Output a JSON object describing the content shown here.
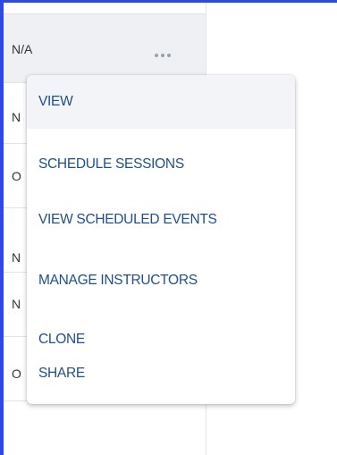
{
  "table": {
    "rows": [
      {
        "value": "N/A"
      },
      {
        "value": "N"
      },
      {
        "value": "O"
      },
      {
        "value": "N"
      },
      {
        "value": "N"
      },
      {
        "value": "O"
      }
    ]
  },
  "context_menu": {
    "items": [
      {
        "label": "VIEW",
        "highlighted": true
      },
      {
        "label": "SCHEDULE SESSIONS"
      },
      {
        "label": "VIEW SCHEDULED EVENTS"
      },
      {
        "label": "MANAGE INSTRUCTORS"
      },
      {
        "label": "CLONE"
      },
      {
        "label": "SHARE"
      }
    ]
  },
  "colors": {
    "accent": "#2f49e6",
    "menu_text": "#1f4f86",
    "row_highlight": "#eef0f3"
  },
  "icons": {
    "row_actions": "more-horizontal-icon"
  }
}
